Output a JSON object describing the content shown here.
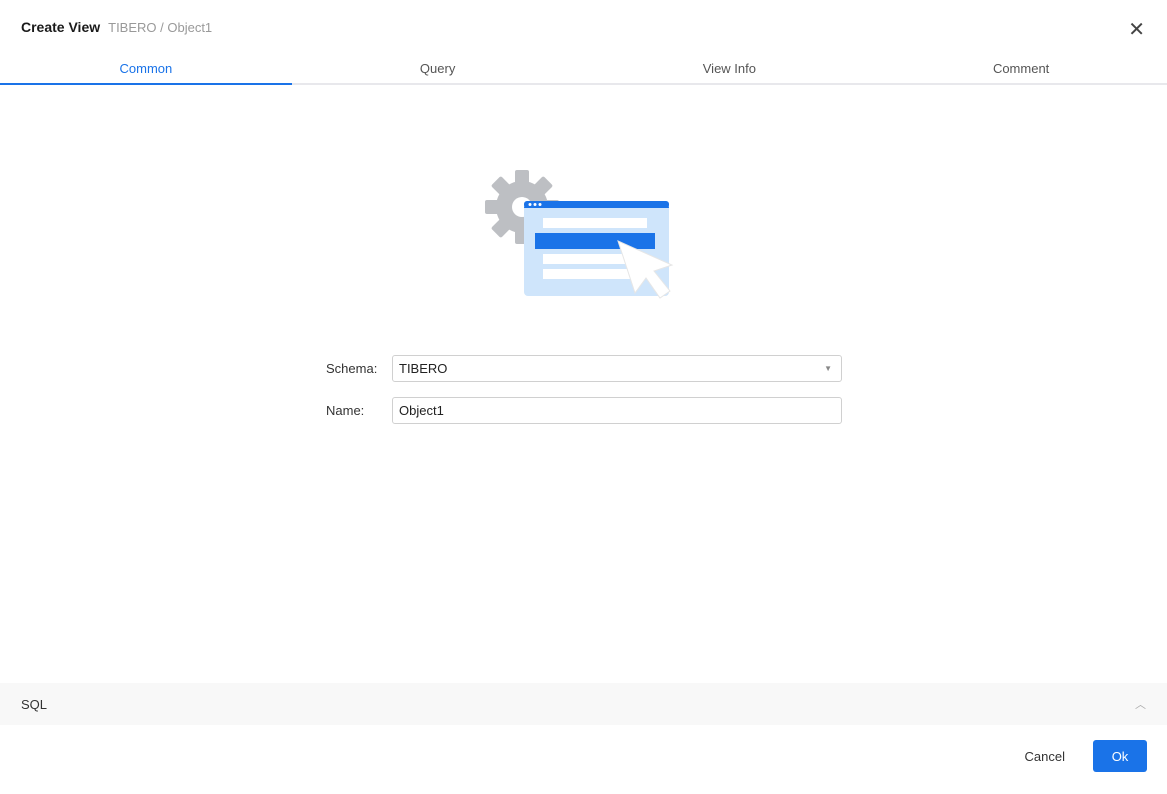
{
  "dialog": {
    "title": "Create View",
    "breadcrumb": "TIBERO / Object1",
    "close_icon": "close-icon"
  },
  "tabs": [
    {
      "label": "Common"
    },
    {
      "label": "Query"
    },
    {
      "label": "View Info"
    },
    {
      "label": "Comment"
    }
  ],
  "form": {
    "schema_label": "Schema:",
    "schema_value": "TIBERO",
    "name_label": "Name:",
    "name_value": "Object1"
  },
  "sql": {
    "label": "SQL"
  },
  "footer": {
    "cancel": "Cancel",
    "ok": "Ok"
  }
}
